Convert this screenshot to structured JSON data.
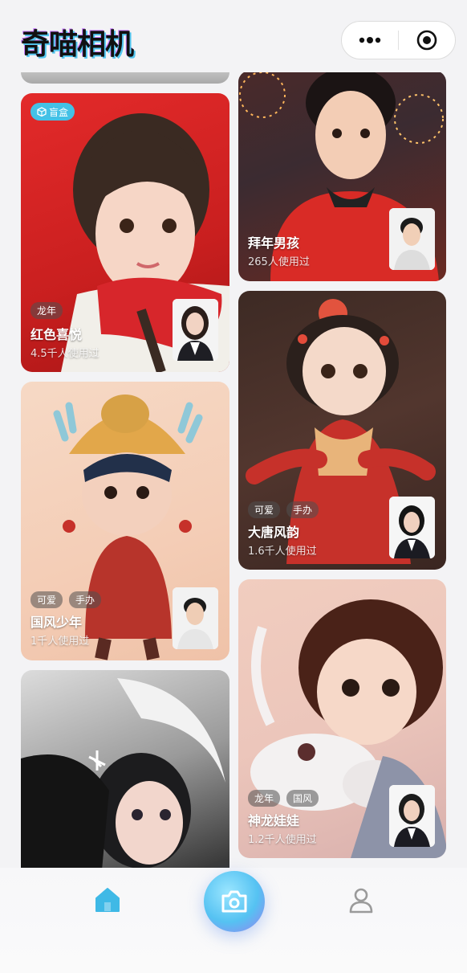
{
  "app": {
    "title": "奇喵相机"
  },
  "capsule": {
    "more_icon": "more-dots-icon",
    "close_icon": "target-icon"
  },
  "cards": {
    "hongse": {
      "badge": "盲盒",
      "tags": [
        "龙年"
      ],
      "title": "红色喜悦",
      "usage": "4.5千人使用过"
    },
    "bainian": {
      "tags": [],
      "title": "拜年男孩",
      "usage": "265人使用过"
    },
    "guofeng": {
      "tags": [
        "可爱",
        "手办"
      ],
      "title": "国风少年",
      "usage": "1千人使用过"
    },
    "datang": {
      "tags": [
        "可爱",
        "手办"
      ],
      "title": "大唐风韵",
      "usage": "1.6千人使用过"
    },
    "shenlong": {
      "tags": [
        "龙年",
        "国风"
      ],
      "title": "神龙娃娃",
      "usage": "1.2千人使用过"
    },
    "xuelong": {
      "tags": [],
      "title": "",
      "usage": ""
    }
  },
  "tabbar": {
    "home_icon": "home-icon",
    "camera_icon": "camera-icon",
    "profile_icon": "user-icon"
  },
  "colors": {
    "accent": "#43c1e6",
    "background": "#f3f3f5"
  }
}
